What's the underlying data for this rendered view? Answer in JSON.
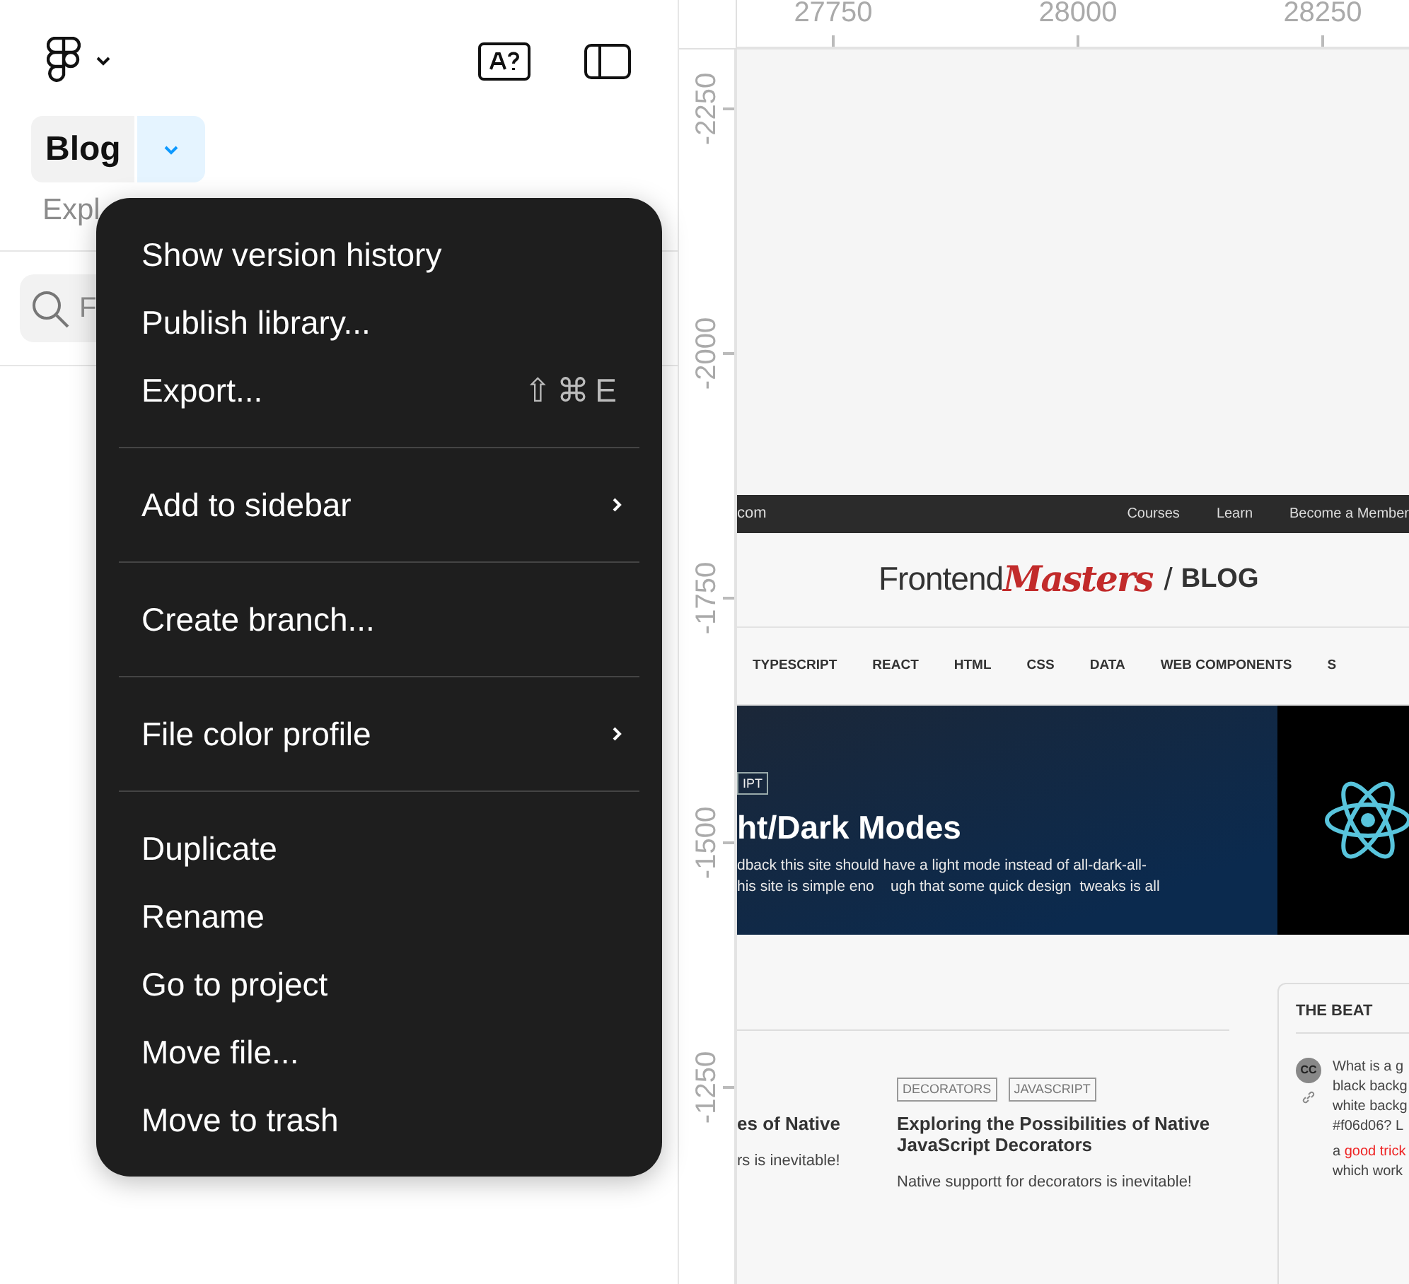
{
  "sidebar": {
    "file_name": "Blog",
    "menu_open": true,
    "subtitle": "Expl",
    "search": {
      "placeholder": "F"
    }
  },
  "menu": {
    "sections": [
      [
        {
          "label": "Show version history"
        },
        {
          "label": "Publish library..."
        },
        {
          "label": "Export...",
          "shortcut": "⇧⌘E"
        }
      ],
      [
        {
          "label": "Add to sidebar",
          "submenu": true
        }
      ],
      [
        {
          "label": "Create branch..."
        }
      ],
      [
        {
          "label": "File color profile",
          "submenu": true
        }
      ],
      [
        {
          "label": "Duplicate"
        },
        {
          "label": "Rename"
        },
        {
          "label": "Go to project"
        },
        {
          "label": "Move file..."
        },
        {
          "label": "Move to trash"
        }
      ]
    ]
  },
  "rulers": {
    "x_ticks": [
      "27750",
      "28000",
      "28250"
    ],
    "y_ticks": [
      "-2250",
      "-2000",
      "-1750",
      "-1500",
      "-1250"
    ]
  },
  "frame": {
    "top_bar": {
      "site": "com",
      "links": [
        "Courses",
        "Learn",
        "Become a Member"
      ]
    },
    "logo": {
      "word1": "Frontend",
      "word2": "Masters",
      "separator": "/",
      "section": "BLOG"
    },
    "nav": [
      "TYPESCRIPT",
      "REACT",
      "HTML",
      "CSS",
      "DATA",
      "WEB COMPONENTS",
      "S"
    ],
    "hero": {
      "tag": "IPT",
      "title": "ht/Dark Modes",
      "lines": [
        "dback this site should have a light mode instead of all-dark-all-",
        "his site is simple eno    ugh that some quick design  tweaks is all"
      ]
    },
    "posts": [
      {
        "title": "es of Native",
        "excerpt": "rs is inevitable!"
      },
      {
        "tags": [
          "DECORATORS",
          "JAVASCRIPT"
        ],
        "title": "Exploring the Possibilities of Native JavaScript Decorators",
        "excerpt": "Native supportt for decorators is inevitable!"
      }
    ],
    "beat": {
      "title": "THE BEAT",
      "avatar": "CC",
      "lines": [
        {
          "text": "What is a g"
        },
        {
          "text": "black backg"
        },
        {
          "text": "white backg"
        },
        {
          "text": "#f06d06? L"
        },
        {
          "text": "a",
          "link": "good trick"
        },
        {
          "text": "which work"
        }
      ]
    }
  }
}
